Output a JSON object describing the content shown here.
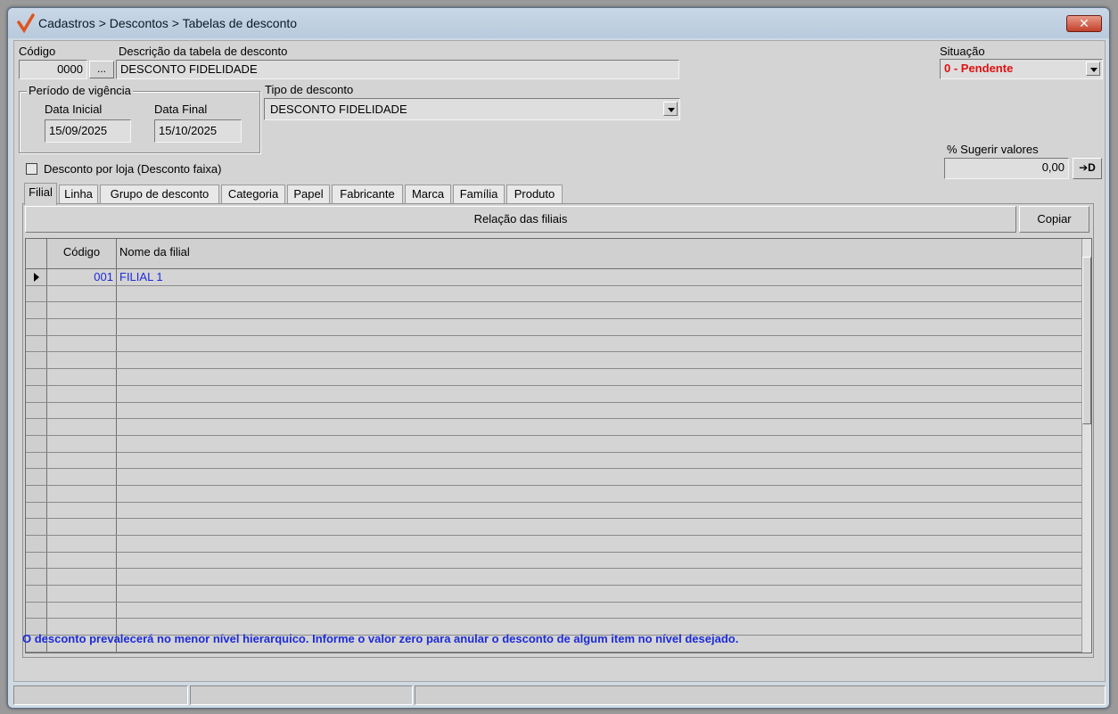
{
  "window": {
    "title": "Cadastros > Descontos > Tabelas de desconto",
    "close_label": "✕"
  },
  "form": {
    "codigo_label": "Código",
    "codigo_value": "0000",
    "lookup_label": "...",
    "descricao_label": "Descrição da tabela de desconto",
    "descricao_value": "DESCONTO FIDELIDADE",
    "situacao_label": "Situação",
    "situacao_value": "0 - Pendente",
    "periodo_label": "Período de vigência",
    "data_inicial_label": "Data Inicial",
    "data_inicial_value": "15/09/2025",
    "data_final_label": "Data Final",
    "data_final_value": "15/10/2025",
    "tipo_label": "Tipo de desconto",
    "tipo_value": "DESCONTO FIDELIDADE",
    "checkbox_label": "Desconto por loja (Desconto faixa)",
    "checkbox_checked": false,
    "sugerir_label": "% Sugerir valores",
    "sugerir_value": "0,00",
    "apply_label": "➔D"
  },
  "tabs": [
    {
      "label": "Filial",
      "active": true
    },
    {
      "label": "Linha"
    },
    {
      "label": "Grupo de desconto"
    },
    {
      "label": "Categoria"
    },
    {
      "label": "Papel"
    },
    {
      "label": "Fabricante"
    },
    {
      "label": "Marca"
    },
    {
      "label": "Família"
    },
    {
      "label": "Produto"
    }
  ],
  "panel": {
    "header": "Relação das filiais",
    "copy_label": "Copiar"
  },
  "grid": {
    "columns": [
      "Código",
      "Nome da filial"
    ],
    "rows": [
      {
        "codigo": "001",
        "nome": "FILIAL 1"
      }
    ]
  },
  "hint": "O desconto prevalecerá no menor nível hierarquico. Informe o valor zero para anular o desconto de algum item no nível desejado.",
  "colors": {
    "situacao": "#e01010",
    "hint": "#1c2bd8",
    "grid_text": "#1c2bd8"
  }
}
